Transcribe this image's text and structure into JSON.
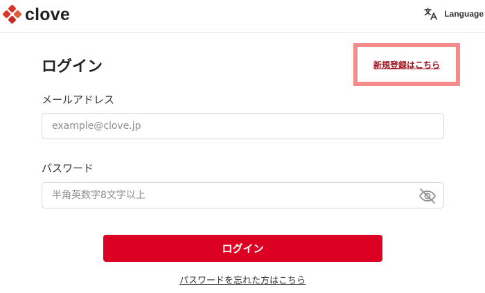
{
  "brand": {
    "name": "clove",
    "accent": "#dc0023"
  },
  "header": {
    "language_label": "Language",
    "language_icon": "translate-icon"
  },
  "login": {
    "title": "ログイン",
    "signup_link": "新規登録はこちら",
    "email": {
      "label": "メールアドレス",
      "placeholder": "example@clove.jp",
      "value": ""
    },
    "password": {
      "label": "パスワード",
      "placeholder": "半角英数字8文字以上",
      "value": "",
      "toggle_icon": "eye-off-icon"
    },
    "submit_label": "ログイン",
    "forgot_link": "パスワードを忘れた方はこちら"
  }
}
